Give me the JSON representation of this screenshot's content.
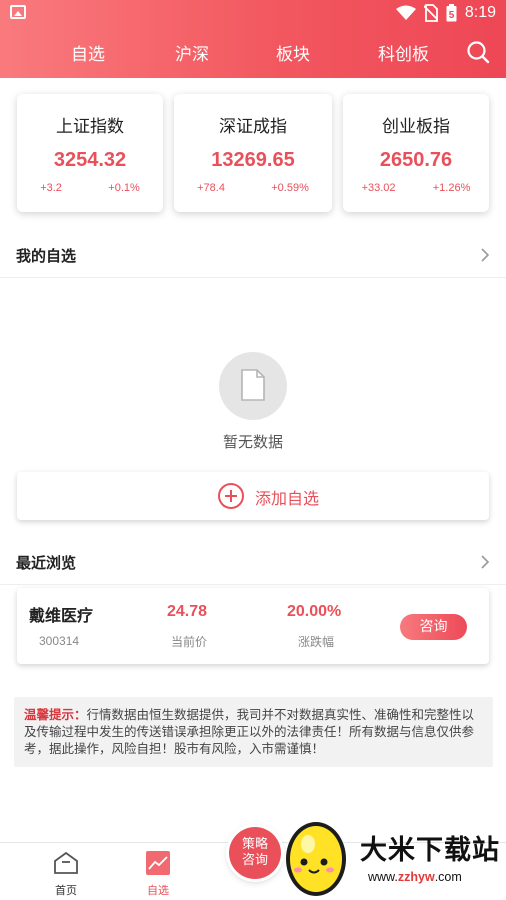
{
  "status_bar": {
    "time": "8:19",
    "battery_level": "5"
  },
  "nav": {
    "tabs": [
      {
        "label": "自选"
      },
      {
        "label": "沪深"
      },
      {
        "label": "板块"
      },
      {
        "label": "科创板"
      }
    ]
  },
  "indices": [
    {
      "name": "上证指数",
      "value": "3254.32",
      "change": "+3.2",
      "change_pct": "+0.1%"
    },
    {
      "name": "深证成指",
      "value": "13269.65",
      "change": "+78.4",
      "change_pct": "+0.59%"
    },
    {
      "name": "创业板指",
      "value": "2650.76",
      "change": "+33.02",
      "change_pct": "+1.26%"
    }
  ],
  "watchlist": {
    "title": "我的自选",
    "empty_text": "暂无数据",
    "add_label": "添加自选"
  },
  "recent": {
    "title": "最近浏览",
    "items": [
      {
        "name": "戴维医疗",
        "code": "300314",
        "price": "24.78",
        "price_label": "当前价",
        "change_pct": "20.00%",
        "change_label": "涨跌幅",
        "action_label": "咨询"
      }
    ]
  },
  "notice": {
    "label": "温馨提示：",
    "text": "行情数据由恒生数据提供，我司并不对数据真实性、准确性和完整性以及传输过程中发生的传送错误承担除更正以外的法律责任！所有数据与信息仅供参考，据此操作，风险自担！股市有风险，入市需谨慎！"
  },
  "bottom_nav": {
    "items": [
      {
        "label": "首页"
      },
      {
        "label": "自选"
      }
    ],
    "strategy_line1": "策略",
    "strategy_line2": "咨询"
  },
  "watermark": {
    "title": "大米下载站",
    "url_prefix": "www.",
    "url_highlight": "zzhyw",
    "url_suffix": ".com"
  },
  "colors": {
    "accent": "#e9505a",
    "header_start": "#f97a7d",
    "header_end": "#ee4756"
  }
}
